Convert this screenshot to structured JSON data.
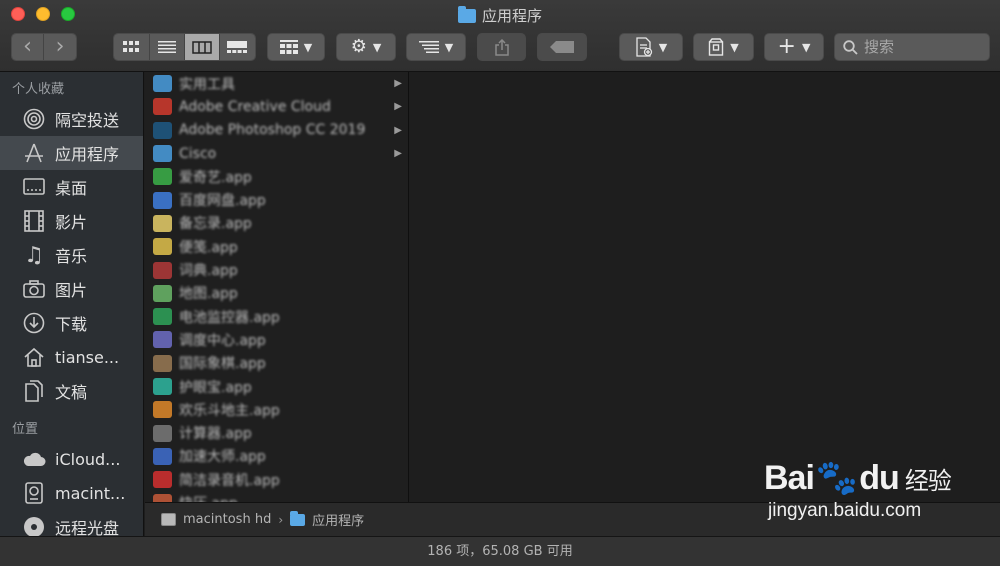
{
  "window": {
    "title": "应用程序"
  },
  "toolbar": {
    "back": "‹",
    "forward": "›",
    "search_placeholder": "搜索"
  },
  "sidebar": {
    "favorites_header": "个人收藏",
    "favorites": [
      {
        "label": "隔空投送",
        "icon": "airdrop-icon",
        "selected": false
      },
      {
        "label": "应用程序",
        "icon": "applications-icon",
        "selected": true
      },
      {
        "label": "桌面",
        "icon": "desktop-icon",
        "selected": false
      },
      {
        "label": "影片",
        "icon": "film-icon",
        "selected": false
      },
      {
        "label": "音乐",
        "icon": "music-icon",
        "selected": false
      },
      {
        "label": "图片",
        "icon": "camera-icon",
        "selected": false
      },
      {
        "label": "下载",
        "icon": "download-icon",
        "selected": false
      },
      {
        "label": "tianse...",
        "icon": "home-icon",
        "selected": false
      },
      {
        "label": "文稿",
        "icon": "documents-icon",
        "selected": false
      }
    ],
    "locations_header": "位置",
    "locations": [
      {
        "label": "iCloud...",
        "icon": "icloud-icon"
      },
      {
        "label": "macint...",
        "icon": "disk-icon"
      },
      {
        "label": "远程光盘",
        "icon": "disc-icon"
      }
    ]
  },
  "files": [
    {
      "name": "实用工具",
      "color": "#4a9fe0",
      "folder": true
    },
    {
      "name": "Adobe Creative Cloud",
      "color": "#d23b2e",
      "folder": true
    },
    {
      "name": "Adobe Photoshop CC 2019",
      "color": "#1e5a86",
      "folder": true
    },
    {
      "name": "Cisco",
      "color": "#4a9fe0",
      "folder": true
    },
    {
      "name": "爱奇艺.app",
      "color": "#3cb34a",
      "folder": false
    },
    {
      "name": "百度网盘.app",
      "color": "#3f7fe0",
      "folder": false
    },
    {
      "name": "备忘录.app",
      "color": "#e8cf6a",
      "folder": false
    },
    {
      "name": "便笺.app",
      "color": "#e2c24c",
      "folder": false
    },
    {
      "name": "词典.app",
      "color": "#b33a3a",
      "folder": false
    },
    {
      "name": "地图.app",
      "color": "#6bb86a",
      "folder": false
    },
    {
      "name": "电池监控器.app",
      "color": "#2fa55a",
      "folder": false
    },
    {
      "name": "调度中心.app",
      "color": "#6e6ec8",
      "folder": false
    },
    {
      "name": "国际象棋.app",
      "color": "#9a7a55",
      "folder": false
    },
    {
      "name": "护眼宝.app",
      "color": "#2fb8a2",
      "folder": false
    },
    {
      "name": "欢乐斗地主.app",
      "color": "#e08a2a",
      "folder": false
    },
    {
      "name": "计算器.app",
      "color": "#7a7a7a",
      "folder": false
    },
    {
      "name": "加速大师.app",
      "color": "#3f6fd0",
      "folder": false
    },
    {
      "name": "简洁录音机.app",
      "color": "#d63030",
      "folder": false
    },
    {
      "name": "快压.app",
      "color": "#c85a3a",
      "folder": false
    }
  ],
  "pathbar": {
    "disk": "macintosh hd",
    "separator": "›",
    "folder": "应用程序"
  },
  "status": {
    "text": "186 项，65.08 GB 可用"
  },
  "watermark": {
    "brand_a": "Bai",
    "brand_b": "du",
    "brand_cn": "经验",
    "url": "jingyan.baidu.com"
  }
}
